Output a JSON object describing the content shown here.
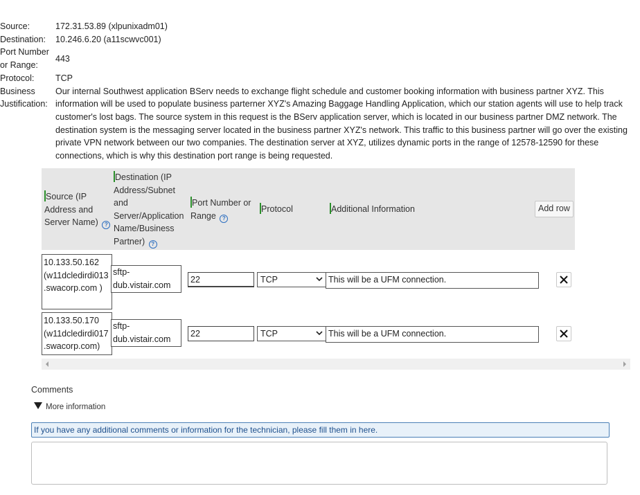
{
  "info": {
    "source_label": "Source:",
    "source_value": "172.31.53.89 (xlpunixadm01)",
    "destination_label": "Destination:",
    "destination_value": "10.246.6.20 (a11scwvc001)",
    "port_label_line1": "Port Number",
    "port_label_line2": "or Range:",
    "port_value": "443",
    "protocol_label": "Protocol:",
    "protocol_value": "TCP",
    "justification_label_line1": "Business",
    "justification_label_line2": "Justification:",
    "justification_value": "Our internal Southwest application BServ needs to exchange flight schedule and customer booking information with business partner XYZ. This information will be used to populate business parterner XYZ's Amazing Baggage Handling Application, which our station agents will use to help track customer's lost bags. The source system in this request is the BServ application server, which is located in our business partner DMZ network. The destination system is the messaging server located in the business partner XYZ's network. This traffic to this business partner will go over the existing private VPN network between our two companies. The destination server at XYZ, utilizes dynamic ports in the range of 12578-12590 for these connections, which is why this destination port range is being requested."
  },
  "table": {
    "headers": {
      "source_l1": "Source (IP",
      "source_l2": "Address and",
      "source_l3": "Server Name)",
      "destination_l1": "Destination (IP",
      "destination_l2": "Address/Subnet",
      "destination_l3": "and",
      "destination_l4": "Server/Application",
      "destination_l5": "Name/Business",
      "destination_l6": "Partner)",
      "port_l1": "Port Number or",
      "port_l2": "Range",
      "protocol": "Protocol",
      "additional": "Additional Information"
    },
    "add_row_label": "Add row",
    "rows": [
      {
        "source_l1": "10.133.50.162",
        "source_l2": "(w11dcledirdi013",
        "source_l3": ".swacorp.com )",
        "dest_l1": "sftp-",
        "dest_l2": "dub.vistair.com",
        "port": "22",
        "protocol": "TCP",
        "info": "This will be a UFM connection."
      },
      {
        "source_l1": "10.133.50.170",
        "source_l2": "(w11dcledirdi017",
        "source_l3": ".swacorp.com)",
        "dest_l1": "sftp-",
        "dest_l2": "dub.vistair.com",
        "port": "22",
        "protocol": "TCP",
        "info": "This will be a UFM connection."
      }
    ]
  },
  "comments": {
    "label": "Comments",
    "more_info": "More information",
    "hint": "If you have any additional comments or information for the technician, please fill them in here.",
    "value": ""
  },
  "icons": {
    "help": "help-circle-icon",
    "delete": "close-x-icon",
    "dropdown": "chevron-down-icon",
    "expand": "triangle-down-icon"
  },
  "colors": {
    "required_marker": "#2a8f2a",
    "help_icon": "#2d6fc0",
    "header_bg": "#e6e6e6",
    "hint_bg": "#e8f1f9",
    "hint_border": "#4a7fb6"
  }
}
